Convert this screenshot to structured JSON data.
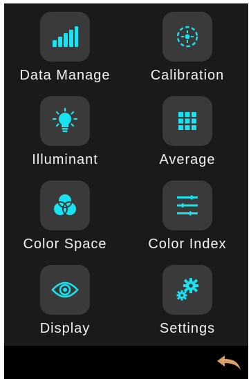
{
  "colors": {
    "background": "#1a1a1a",
    "tile": "#3a3a3a",
    "accent": "#19e3f0",
    "text": "#f2f2f2",
    "bottom_bar": "#000000",
    "back_arrow": "#d9a06a"
  },
  "menu": {
    "items": [
      {
        "label": "Data Manage",
        "icon": "signal-bars-icon"
      },
      {
        "label": "Calibration",
        "icon": "calibration-target-icon"
      },
      {
        "label": "Illuminant",
        "icon": "lightbulb-icon"
      },
      {
        "label": "Average",
        "icon": "grid-dots-icon"
      },
      {
        "label": "Color Space",
        "icon": "color-circles-icon"
      },
      {
        "label": "Color Index",
        "icon": "sliders-lines-icon"
      },
      {
        "label": "Display",
        "icon": "eye-icon"
      },
      {
        "label": "Settings",
        "icon": "gears-icon"
      }
    ]
  },
  "footer": {
    "back_icon": "back-arrow-icon"
  }
}
